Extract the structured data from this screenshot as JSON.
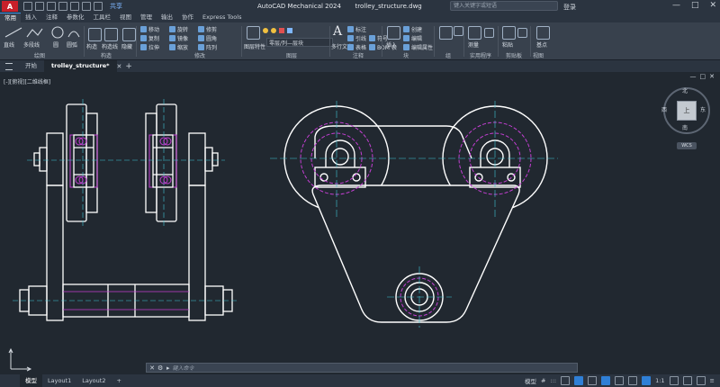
{
  "titlebar": {
    "logo": "A",
    "share": "共享",
    "app_title": "AutoCAD Mechanical 2024",
    "file": "trolley_structure.dwg",
    "search_placeholder": "键入关键字或短语",
    "login": "登录",
    "min": "—",
    "max": "□",
    "close": "✕"
  },
  "ribbon_tabs": [
    "常用",
    "插入",
    "注释",
    "参数化",
    "工具栏",
    "视图",
    "管理",
    "输出",
    "协作",
    "Express Tools"
  ],
  "ribbon": {
    "draw": {
      "title": "绘图",
      "line": "直线",
      "polyline": "多段线",
      "circle": "圆",
      "arc": "圆弧"
    },
    "construct": {
      "title": "构造",
      "label1": "构造",
      "label2": "构造线"
    },
    "hide": {
      "label": "隐藏"
    },
    "modify": {
      "title": "修改",
      "move": "移动",
      "rotate": "旋转",
      "trim": "修剪",
      "copy": "复制",
      "mirror": "镜像",
      "fillet": "圆角",
      "stretch": "拉伸",
      "scale": "缩放",
      "array": "阵列"
    },
    "layers": {
      "title": "图层",
      "current": "零层/列—层块",
      "layer_props": "图层特性"
    },
    "annotation": {
      "title": "注释",
      "text": "多行文字",
      "dim": "标注",
      "leader": "引线",
      "table": "表格",
      "bom": "BOM 表",
      "symbol": "符号"
    },
    "block": {
      "title": "块",
      "insert": "插入",
      "create": "创建",
      "edit": "编辑",
      "attr": "编辑属性"
    },
    "groups": {
      "title": "组"
    },
    "utilities": {
      "title": "实用程序",
      "measure": "测量"
    },
    "clipboard": {
      "title": "剪贴板",
      "paste": "粘贴"
    },
    "view": {
      "title": "视图",
      "base": "基点"
    }
  },
  "doctabs": {
    "start": "开始",
    "active": "trolley_structure*",
    "new": "+"
  },
  "viewport": {
    "label": "[-][俯视][二维线框]",
    "ctl_min": "—",
    "ctl_max": "□",
    "ctl_close": "✕"
  },
  "viewcube": {
    "north": "北",
    "south": "南",
    "east": "东",
    "west": "西",
    "top": "上",
    "wcs": "WCS"
  },
  "command": {
    "placeholder": "键入命令"
  },
  "status": {
    "model": "模型",
    "layout1": "Layout1",
    "layout2": "Layout2",
    "add": "+",
    "model_right": "模型",
    "grid": "#",
    "snap": ":::",
    "scale": "1:1"
  },
  "colors": {
    "bg": "#212830",
    "line": "#ffffff",
    "magenta": "#c33fd2",
    "cyan": "#3fc6d6",
    "ribbon": "#38414d"
  }
}
